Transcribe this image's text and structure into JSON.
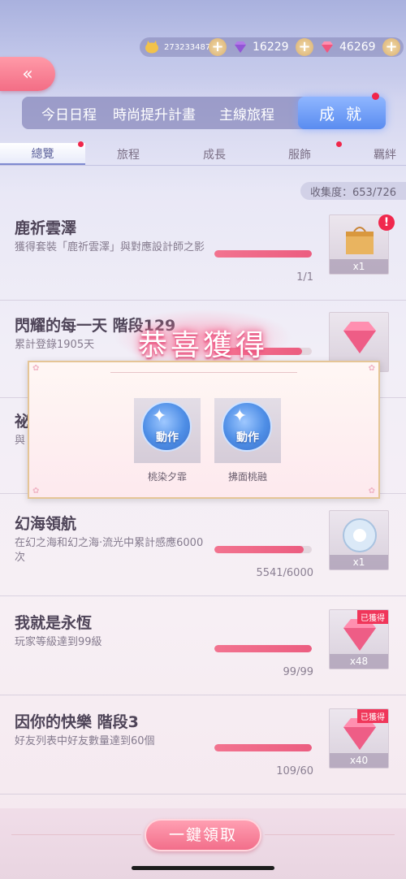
{
  "currency": {
    "gold": "273233487",
    "diamond_purple": "16229",
    "diamond_pink": "46269"
  },
  "main_tabs": [
    "今日日程",
    "時尚提升計畫",
    "主線旅程",
    "成 就"
  ],
  "sub_tabs": [
    "總覽",
    "旅程",
    "成長",
    "服飾",
    "羈絆"
  ],
  "collection": "收集度：653/726",
  "rows": [
    {
      "title": "鹿祈雲澤",
      "desc": "獲得套裝「鹿祈雲澤」與對應設計師之影",
      "count": "1/1",
      "progress": 1.0,
      "qty": "x1",
      "claimed": ""
    },
    {
      "title": "閃耀的每一天 階段129",
      "desc": "累計登錄1905天",
      "count": "",
      "progress": 0.9,
      "qty": "",
      "claimed": ""
    },
    {
      "title": "祕",
      "desc": "與",
      "count": "",
      "progress": 0.0,
      "qty": "",
      "claimed": ""
    },
    {
      "title": "幻海領航",
      "desc": "在幻之海和幻之海·流光中累計感應6000次",
      "count": "5541/6000",
      "progress": 0.92,
      "qty": "x1",
      "claimed": ""
    },
    {
      "title": "我就是永恆",
      "desc": "玩家等級達到99級",
      "count": "99/99",
      "progress": 1.0,
      "qty": "x48",
      "claimed": "已獲得"
    },
    {
      "title": "因你的快樂 階段3",
      "desc": "好友列表中好友數量達到60個",
      "count": "109/60",
      "progress": 1.0,
      "qty": "x40",
      "claimed": "已獲得"
    }
  ],
  "popup": {
    "title": "恭喜獲得",
    "items": [
      {
        "label": "動作",
        "name": "桃染夕霏"
      },
      {
        "label": "動作",
        "name": "拂面桃融"
      }
    ]
  },
  "claim_all": "一鍵領取",
  "colors": {
    "accent": "#f26e8a",
    "active_tab": "#5a8cf0",
    "badge": "#f0365a"
  }
}
